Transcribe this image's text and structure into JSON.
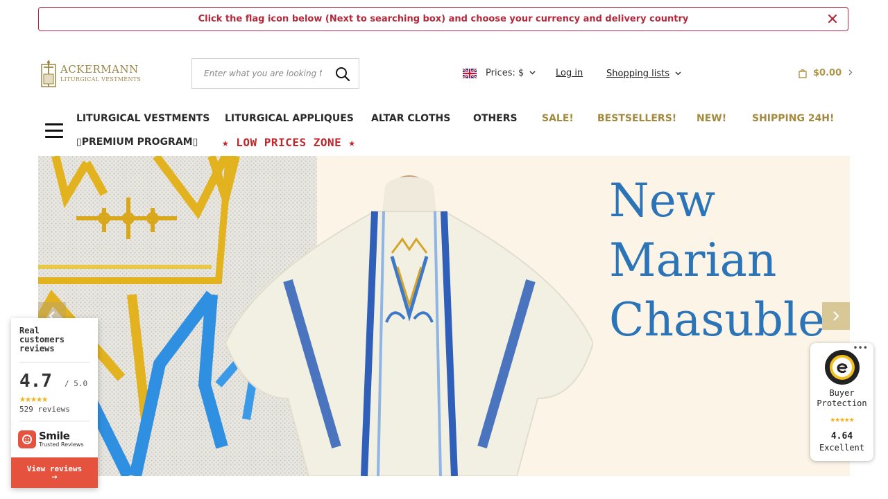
{
  "notice": {
    "text": "Click the flag icon below (Next to searching box) and choose your currency and delivery country",
    "close_icon": "close-icon"
  },
  "header": {
    "logo_name": "ACKERMANN",
    "logo_sub": "LITURGICAL VESTMENTS",
    "search_placeholder": "Enter what you are looking for",
    "currency_label": "Prices: $",
    "login_label": "Log in",
    "lists_label": "Shopping lists",
    "cart_total": "$0.00"
  },
  "nav": {
    "row1": [
      "LITURGICAL VESTMENTS",
      "LITURGICAL APPLIQUES",
      "ALTAR CLOTHS",
      "OTHERS",
      "SALE!",
      "BESTSELLERS!",
      "NEW!",
      "SHIPPING 24H!"
    ],
    "premium": "▯PREMIUM PROGRAM▯",
    "low_prices": "★ LOW PRICES ZONE ★"
  },
  "banner": {
    "line1": "New",
    "line2": "Marian",
    "line3": "Chasuble"
  },
  "reviews_widget": {
    "title": "Real customers reviews",
    "score": "4.7",
    "out_of": "/ 5.0",
    "stars": "★★★★★",
    "count": "529 reviews",
    "brand_name": "Smile",
    "brand_sub": "Trusted Reviews",
    "button_label": "View reviews",
    "button_arrow": "→"
  },
  "trusted_shops": {
    "more": "•••",
    "title_line1": "Buyer",
    "title_line2": "Protection",
    "stars": "★★★★★",
    "score": "4.64",
    "label": "Excellent"
  },
  "colors": {
    "notice_red": "#b3283a",
    "gold": "#a48a40",
    "headline_blue": "#2b74b8",
    "sale_red": "#c0282e",
    "smile_orange": "#e5533f"
  }
}
